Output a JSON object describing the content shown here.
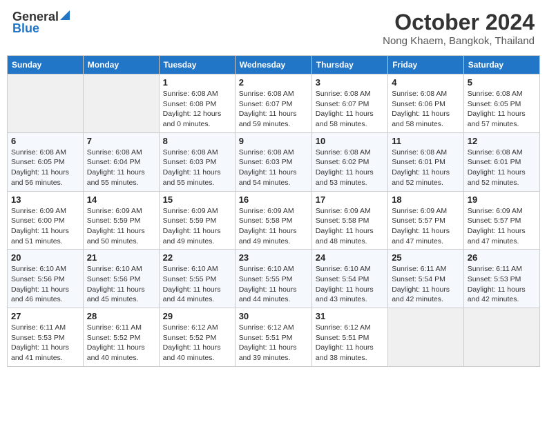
{
  "header": {
    "logo_general": "General",
    "logo_blue": "Blue",
    "title": "October 2024",
    "subtitle": "Nong Khaem, Bangkok, Thailand"
  },
  "weekdays": [
    "Sunday",
    "Monday",
    "Tuesday",
    "Wednesday",
    "Thursday",
    "Friday",
    "Saturday"
  ],
  "weeks": [
    [
      {
        "day": "",
        "empty": true
      },
      {
        "day": "",
        "empty": true
      },
      {
        "day": "1",
        "sunrise": "6:08 AM",
        "sunset": "6:08 PM",
        "daylight": "12 hours and 0 minutes."
      },
      {
        "day": "2",
        "sunrise": "6:08 AM",
        "sunset": "6:07 PM",
        "daylight": "11 hours and 59 minutes."
      },
      {
        "day": "3",
        "sunrise": "6:08 AM",
        "sunset": "6:07 PM",
        "daylight": "11 hours and 58 minutes."
      },
      {
        "day": "4",
        "sunrise": "6:08 AM",
        "sunset": "6:06 PM",
        "daylight": "11 hours and 58 minutes."
      },
      {
        "day": "5",
        "sunrise": "6:08 AM",
        "sunset": "6:05 PM",
        "daylight": "11 hours and 57 minutes."
      }
    ],
    [
      {
        "day": "6",
        "sunrise": "6:08 AM",
        "sunset": "6:05 PM",
        "daylight": "11 hours and 56 minutes."
      },
      {
        "day": "7",
        "sunrise": "6:08 AM",
        "sunset": "6:04 PM",
        "daylight": "11 hours and 55 minutes."
      },
      {
        "day": "8",
        "sunrise": "6:08 AM",
        "sunset": "6:03 PM",
        "daylight": "11 hours and 55 minutes."
      },
      {
        "day": "9",
        "sunrise": "6:08 AM",
        "sunset": "6:03 PM",
        "daylight": "11 hours and 54 minutes."
      },
      {
        "day": "10",
        "sunrise": "6:08 AM",
        "sunset": "6:02 PM",
        "daylight": "11 hours and 53 minutes."
      },
      {
        "day": "11",
        "sunrise": "6:08 AM",
        "sunset": "6:01 PM",
        "daylight": "11 hours and 52 minutes."
      },
      {
        "day": "12",
        "sunrise": "6:08 AM",
        "sunset": "6:01 PM",
        "daylight": "11 hours and 52 minutes."
      }
    ],
    [
      {
        "day": "13",
        "sunrise": "6:09 AM",
        "sunset": "6:00 PM",
        "daylight": "11 hours and 51 minutes."
      },
      {
        "day": "14",
        "sunrise": "6:09 AM",
        "sunset": "5:59 PM",
        "daylight": "11 hours and 50 minutes."
      },
      {
        "day": "15",
        "sunrise": "6:09 AM",
        "sunset": "5:59 PM",
        "daylight": "11 hours and 49 minutes."
      },
      {
        "day": "16",
        "sunrise": "6:09 AM",
        "sunset": "5:58 PM",
        "daylight": "11 hours and 49 minutes."
      },
      {
        "day": "17",
        "sunrise": "6:09 AM",
        "sunset": "5:58 PM",
        "daylight": "11 hours and 48 minutes."
      },
      {
        "day": "18",
        "sunrise": "6:09 AM",
        "sunset": "5:57 PM",
        "daylight": "11 hours and 47 minutes."
      },
      {
        "day": "19",
        "sunrise": "6:09 AM",
        "sunset": "5:57 PM",
        "daylight": "11 hours and 47 minutes."
      }
    ],
    [
      {
        "day": "20",
        "sunrise": "6:10 AM",
        "sunset": "5:56 PM",
        "daylight": "11 hours and 46 minutes."
      },
      {
        "day": "21",
        "sunrise": "6:10 AM",
        "sunset": "5:56 PM",
        "daylight": "11 hours and 45 minutes."
      },
      {
        "day": "22",
        "sunrise": "6:10 AM",
        "sunset": "5:55 PM",
        "daylight": "11 hours and 44 minutes."
      },
      {
        "day": "23",
        "sunrise": "6:10 AM",
        "sunset": "5:55 PM",
        "daylight": "11 hours and 44 minutes."
      },
      {
        "day": "24",
        "sunrise": "6:10 AM",
        "sunset": "5:54 PM",
        "daylight": "11 hours and 43 minutes."
      },
      {
        "day": "25",
        "sunrise": "6:11 AM",
        "sunset": "5:54 PM",
        "daylight": "11 hours and 42 minutes."
      },
      {
        "day": "26",
        "sunrise": "6:11 AM",
        "sunset": "5:53 PM",
        "daylight": "11 hours and 42 minutes."
      }
    ],
    [
      {
        "day": "27",
        "sunrise": "6:11 AM",
        "sunset": "5:53 PM",
        "daylight": "11 hours and 41 minutes."
      },
      {
        "day": "28",
        "sunrise": "6:11 AM",
        "sunset": "5:52 PM",
        "daylight": "11 hours and 40 minutes."
      },
      {
        "day": "29",
        "sunrise": "6:12 AM",
        "sunset": "5:52 PM",
        "daylight": "11 hours and 40 minutes."
      },
      {
        "day": "30",
        "sunrise": "6:12 AM",
        "sunset": "5:51 PM",
        "daylight": "11 hours and 39 minutes."
      },
      {
        "day": "31",
        "sunrise": "6:12 AM",
        "sunset": "5:51 PM",
        "daylight": "11 hours and 38 minutes."
      },
      {
        "day": "",
        "empty": true
      },
      {
        "day": "",
        "empty": true
      }
    ]
  ]
}
